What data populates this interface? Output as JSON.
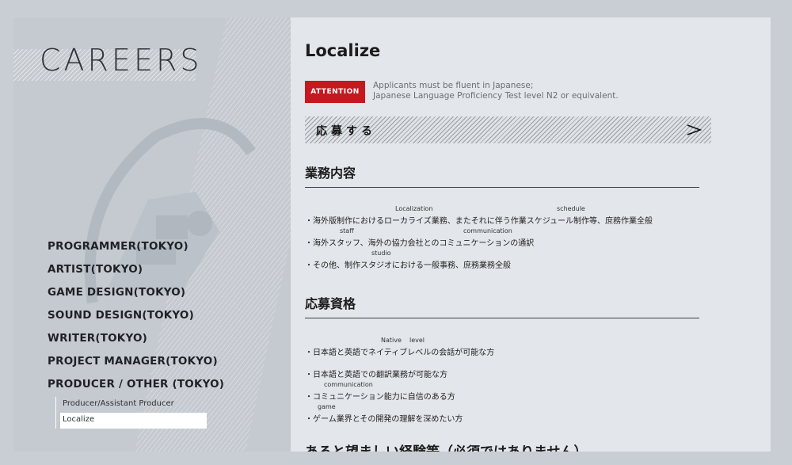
{
  "sidebar": {
    "title": "CAREERS",
    "nav": [
      {
        "label": "PROGRAMMER(TOKYO)"
      },
      {
        "label": "ARTIST(TOKYO)"
      },
      {
        "label": "GAME DESIGN(TOKYO)"
      },
      {
        "label": "SOUND DESIGN(TOKYO)"
      },
      {
        "label": "WRITER(TOKYO)"
      },
      {
        "label": "PROJECT MANAGER(TOKYO)"
      },
      {
        "label": "PRODUCER / OTHER (TOKYO)"
      }
    ],
    "subnav": [
      {
        "label": "Producer/Assistant Producer"
      },
      {
        "label": "Localize"
      }
    ]
  },
  "main": {
    "title": "Localize",
    "attention_badge": "ATTENTION",
    "attention_line1": "Applicants must be fluent in Japanese;",
    "attention_line2": "Japanese Language Proficiency Test level N2 or equivalent.",
    "apply_label": "応募する",
    "sections": [
      {
        "heading": "業務内容",
        "items": [
          {
            "text": "・海外版制作におけるローカライズ業務、またそれに伴う作業スケジュール制作等、庶務作業全般",
            "ruby1": "Localization",
            "ruby2": "schedule"
          },
          {
            "text": "・海外スタッフ、海外の協力会社とのコミュニケーションの通訳",
            "ruby1": "staff",
            "ruby2": "communication"
          },
          {
            "text": "・その他、制作スタジオにおける一般事務、庶務業務全般",
            "ruby1": "studio",
            "ruby2": ""
          }
        ]
      },
      {
        "heading": "応募資格",
        "items": [
          {
            "text": "・日本語と英語でネイティブレベルの会話が可能な方",
            "ruby1": "Native",
            "ruby2": "level"
          },
          {
            "text": "・日本語と英語での翻訳業務が可能な方",
            "ruby1": "",
            "ruby2": ""
          },
          {
            "text": "・コミュニケーション能力に自信のある方",
            "ruby1": "communication",
            "ruby2": ""
          },
          {
            "text": "・ゲーム業界とその開発の理解を深めたい方",
            "ruby1": "game",
            "ruby2": ""
          }
        ]
      },
      {
        "heading": "あると望ましい経験等（必須ではありません）"
      }
    ]
  },
  "icons": {
    "apply_arrow": "chevron-right-icon",
    "emblem": "robot-skull-emblem"
  },
  "colors": {
    "attention": "#c4191f",
    "sidebar_bg": "#c5cad0",
    "content_bg": "#e3e6ea",
    "active_sub": "#ffffff"
  }
}
